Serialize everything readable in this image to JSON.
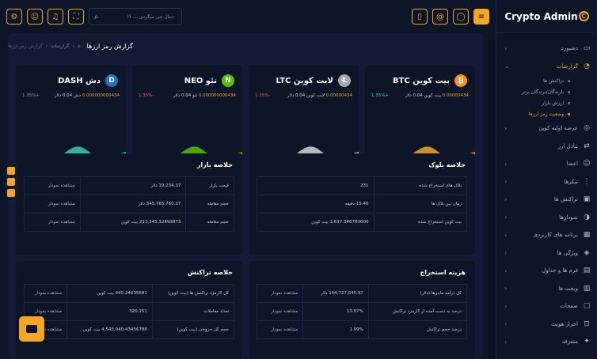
{
  "brand": "Crypto Admin",
  "brand_mark": "C",
  "search": {
    "placeholder": "دنبال چی میگردی ... ؟!"
  },
  "header": {
    "title": "گزارش رمز ارزها",
    "crumb_home": "⌂",
    "crumb_1": "گزارشات",
    "crumb_2": "گزارش رمز ارزها"
  },
  "sidebar": {
    "items": [
      {
        "label": "دشبورد",
        "icon": "monitor-icon"
      },
      {
        "label": "گزارشات",
        "icon": "chart-icon",
        "active": true
      },
      {
        "label": "عرضه اولیه کوین",
        "icon": "coin-icon"
      },
      {
        "label": "تبادل ارز",
        "icon": "exchange-icon"
      },
      {
        "label": "اعضا",
        "icon": "users-icon"
      },
      {
        "label": "تیکرها",
        "icon": "ticker-icon"
      },
      {
        "label": "تراکنش ها",
        "icon": "wallet-icon"
      },
      {
        "label": "نمودارها",
        "icon": "pie-icon"
      },
      {
        "label": "برنامه های کاربردی",
        "icon": "apps-icon"
      },
      {
        "label": "ویژگی ها",
        "icon": "box-icon"
      },
      {
        "label": "فرم ها و جداول",
        "icon": "table-icon"
      },
      {
        "label": "ویجت ها",
        "icon": "widget-icon"
      },
      {
        "label": "صفحات",
        "icon": "page-icon"
      },
      {
        "label": "احراز هویت",
        "icon": "lock-icon"
      },
      {
        "label": "متفرقه",
        "icon": "misc-icon"
      }
    ],
    "sub": [
      {
        "label": "تراکنش ها"
      },
      {
        "label": "بازندگان/برندگان برتر"
      },
      {
        "label": "ارزش بازار"
      },
      {
        "label": "وضعیت رمز ارزها",
        "selected": true
      }
    ]
  },
  "cards": [
    {
      "name": "بیت کوین BTC",
      "symbol": "₿",
      "color": "#f7931a",
      "amount": "0.00000434",
      "rate": "بیت کوین 0.04 دلار",
      "change": "+1.35%",
      "dir": "up",
      "wave": "#f5a623"
    },
    {
      "name": "لایت کوین LTC",
      "symbol": "Ł",
      "color": "#a6a9aa",
      "amount": "0.00000434",
      "rate": "لایت کوین 0.04 دلار",
      "change": "-1.35%",
      "dir": "down",
      "wave": "#cfd5e0"
    },
    {
      "name": "نئو NEO",
      "symbol": "N",
      "color": "#58bf00",
      "amount": "0.000000000434",
      "rate": "نئو 0.04 دلار",
      "change": "-1.35%",
      "dir": "down",
      "wave": "#58bf00"
    },
    {
      "name": "دش DASH",
      "symbol": "D",
      "color": "#1c75bc",
      "amount": "0.000000000434",
      "rate": "دش 0.04 دلار",
      "change": "+1.35%",
      "dir": "up",
      "wave": "#31d0aa"
    }
  ],
  "block_summary": {
    "title": "خلاصه بلوک",
    "rows": [
      {
        "label": "بلاک های استخراج شده",
        "value": "231"
      },
      {
        "label": "زمان بین بلاک ها",
        "value": "15.46 دقیقه"
      },
      {
        "label": "بیت کوین استخراج شده",
        "value": "1,637.546780000 بیت کوین"
      }
    ]
  },
  "market_summary": {
    "title": "خلاصه بازار",
    "rows": [
      {
        "label": "قیمت بازار",
        "value": "19,234.37 دلار",
        "link": "مشاهده نمودار"
      },
      {
        "label": "حجم معامله",
        "value": "345,765,760.27 دلار",
        "link": "مشاهده نمودار"
      },
      {
        "label": "حجم معامله",
        "value": "213,345.32893873 بیت کوین",
        "link": "مشاهده نمودار"
      }
    ]
  },
  "mining_cost": {
    "title": "هزینه استخراج",
    "rows": [
      {
        "label": "کل درآمد ماینرها (دلار)",
        "value": "164,727,645.97 دلار",
        "link": "مشاهده نمودار"
      },
      {
        "label": "درصد به دست آمده از کارمزد تراکنش",
        "value": "13.07%",
        "link": "مشاهده نمودار"
      },
      {
        "label": "درصد حجم تراکنش",
        "value": "1.99%",
        "link": "مشاهده نمودار"
      }
    ]
  },
  "tx_summary": {
    "title": "خلاصه تراکنش",
    "rows": [
      {
        "label": "کل کارمزد تراکنش ها (بیت کوین)",
        "value": "445.24635681 بیت کوین",
        "link": "مشاهده نمودار"
      },
      {
        "label": "تعداد معاملات",
        "value": "320,151",
        "link": "مشاهده نمودار"
      },
      {
        "label": "حجم کل خروجی (بیت کوین)",
        "value": "4,543,040.43456788 بیت کوین",
        "link": "مشاهده نمودار"
      }
    ]
  }
}
